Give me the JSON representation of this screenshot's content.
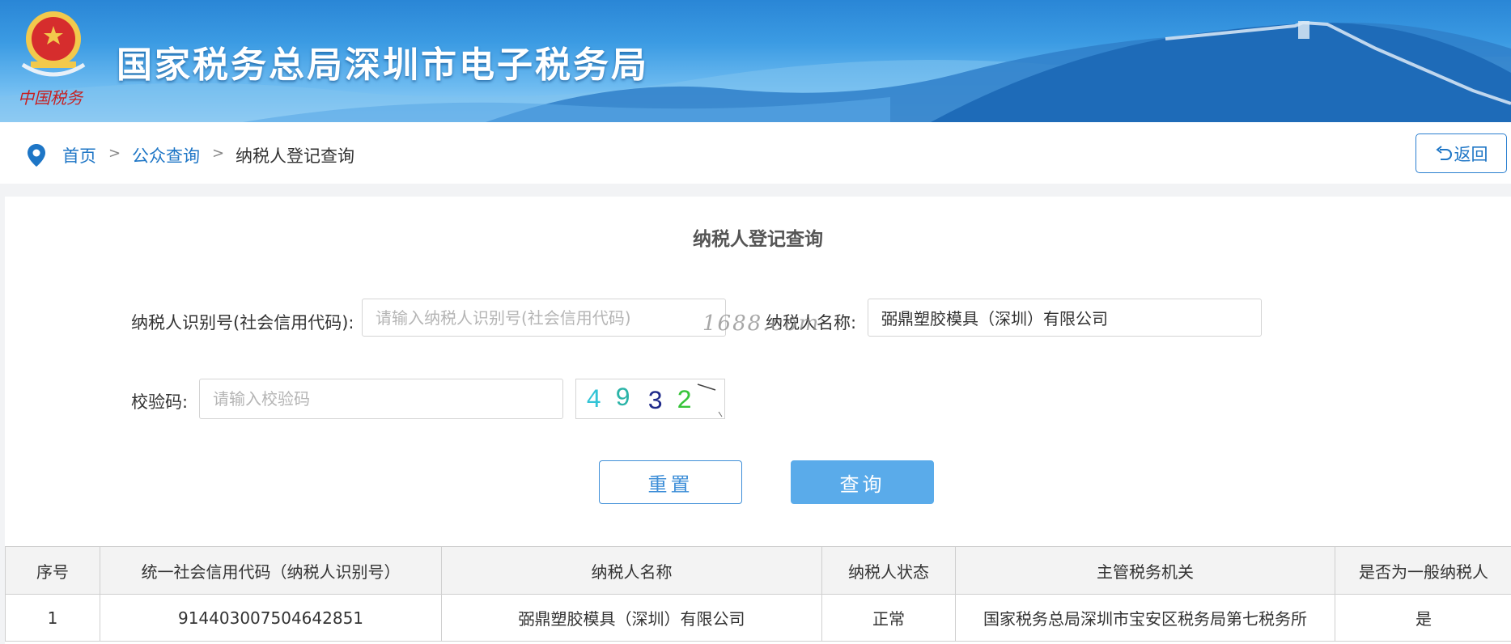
{
  "header": {
    "site_title": "国家税务总局深圳市电子税务局",
    "emblem_text": "中国税务",
    "colors": {
      "banner": "#3b9be3",
      "title_text": "#ffffff"
    }
  },
  "breadcrumb": {
    "items": [
      {
        "label": "首页",
        "link": true
      },
      {
        "label": "公众查询",
        "link": true
      },
      {
        "label": "纳税人登记查询",
        "link": false
      }
    ],
    "separator": ">",
    "back_label": "返回"
  },
  "form": {
    "title": "纳税人登记查询",
    "taxpayer_id": {
      "label": "纳税人识别号(社会信用代码):",
      "placeholder": "请输入纳税人识别号(社会信用代码)",
      "value": ""
    },
    "taxpayer_name": {
      "label": "纳税人名称:",
      "placeholder": "",
      "value": "弼鼎塑胶模具（深圳）有限公司"
    },
    "captcha": {
      "label": "校验码:",
      "placeholder": "请输入校验码",
      "value": "",
      "image_chars": [
        {
          "char": "4",
          "color": "#33c4d6"
        },
        {
          "char": "9",
          "color": "#2bb4a8"
        },
        {
          "char": "3",
          "color": "#1f2a8a"
        },
        {
          "char": "2",
          "color": "#37c43a"
        }
      ]
    },
    "reset_label": "重置",
    "query_label": "查询",
    "watermark": "1688.com"
  },
  "results": {
    "columns": [
      "序号",
      "统一社会信用代码（纳税人识别号）",
      "纳税人名称",
      "纳税人状态",
      "主管税务机关",
      "是否为一般纳税人"
    ],
    "rows": [
      [
        "1",
        "914403007504642851",
        "弼鼎塑胶模具（深圳）有限公司",
        "正常",
        "国家税务总局深圳市宝安区税务局第七税务所",
        "是"
      ]
    ]
  },
  "colors": {
    "accent": "#1e76c6",
    "query_button": "#5aabea",
    "table_header_bg": "#f3f3f3"
  }
}
